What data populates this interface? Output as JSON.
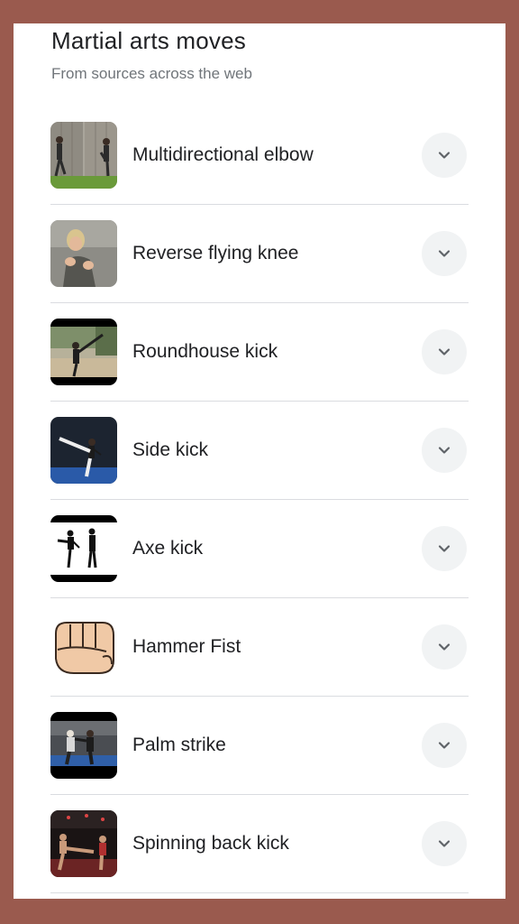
{
  "panel": {
    "title": "Martial arts moves",
    "subtitle": "From sources across the web"
  },
  "items": [
    {
      "label": "Multidirectional elbow",
      "thumb_icon": "two-fighters-wall-photo"
    },
    {
      "label": "Reverse flying knee",
      "thumb_icon": "woman-fighting-stance-photo"
    },
    {
      "label": "Roundhouse kick",
      "thumb_icon": "outdoor-high-kick-photo"
    },
    {
      "label": "Side kick",
      "thumb_icon": "studio-side-kick-photo"
    },
    {
      "label": "Axe kick",
      "thumb_icon": "two-figures-kick-photo"
    },
    {
      "label": "Hammer Fist",
      "thumb_icon": "fist-illustration"
    },
    {
      "label": "Palm strike",
      "thumb_icon": "gym-sparring-photo"
    },
    {
      "label": "Spinning back kick",
      "thumb_icon": "ring-fight-photo"
    }
  ],
  "colors": {
    "frame": "#9a5a4e",
    "card": "#ffffff",
    "title": "#202124",
    "subtitle": "#70757a",
    "divider": "#dadce0",
    "expand_bg": "#f1f3f4"
  }
}
